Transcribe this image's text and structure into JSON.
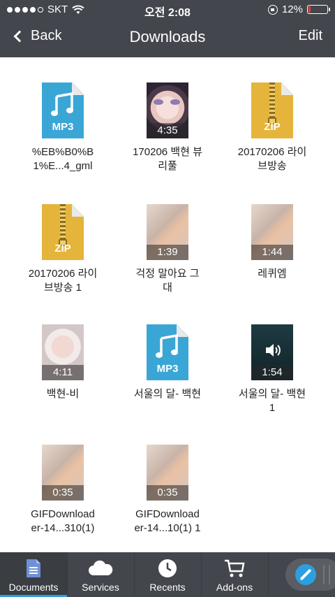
{
  "status_bar": {
    "carrier": "SKT",
    "time": "오전 2:08",
    "battery_percent": "12%",
    "battery_level": 0.12,
    "signal_bars": 4
  },
  "nav": {
    "back_label": "Back",
    "title": "Downloads",
    "edit_label": "Edit"
  },
  "files": [
    {
      "name": "%EB%B0%B\n1%E...4_gml",
      "kind": "mp3",
      "ext": "MP3"
    },
    {
      "name": "170206 백현 뷰\n리풀",
      "kind": "video",
      "duration": "4:35"
    },
    {
      "name": "20170206 라이\n브방송",
      "kind": "zip",
      "ext": "ZIP"
    },
    {
      "name": "20170206 라이\n브방송 1",
      "kind": "zip",
      "ext": "ZIP"
    },
    {
      "name": "걱정 말아요 그\n대",
      "kind": "video",
      "duration": "1:39"
    },
    {
      "name": "레퀴엠",
      "kind": "video",
      "duration": "1:44"
    },
    {
      "name": "백현-비",
      "kind": "video",
      "duration": "4:11"
    },
    {
      "name": "서울의 달- 백현",
      "kind": "mp3",
      "ext": "MP3"
    },
    {
      "name": "서울의 달- 백현\n1",
      "kind": "audio",
      "duration": "1:54"
    },
    {
      "name": "GIFDownload\ner-14...310(1)",
      "kind": "video",
      "duration": "0:35"
    },
    {
      "name": "GIFDownload\ner-14...10(1) 1",
      "kind": "video",
      "duration": "0:35"
    }
  ],
  "tabs": [
    {
      "label": "Documents",
      "icon": "document-icon",
      "active": true
    },
    {
      "label": "Services",
      "icon": "cloud-icon",
      "active": false
    },
    {
      "label": "Recents",
      "icon": "clock-icon",
      "active": false
    },
    {
      "label": "Add-ons",
      "icon": "cart-icon",
      "active": false
    }
  ],
  "colors": {
    "bar_bg": "#43464c",
    "accent": "#2b9fe0",
    "mp3_blue": "#3aa6d6",
    "zip_yellow": "#e5b43a",
    "battery_low": "#ff3b30"
  }
}
